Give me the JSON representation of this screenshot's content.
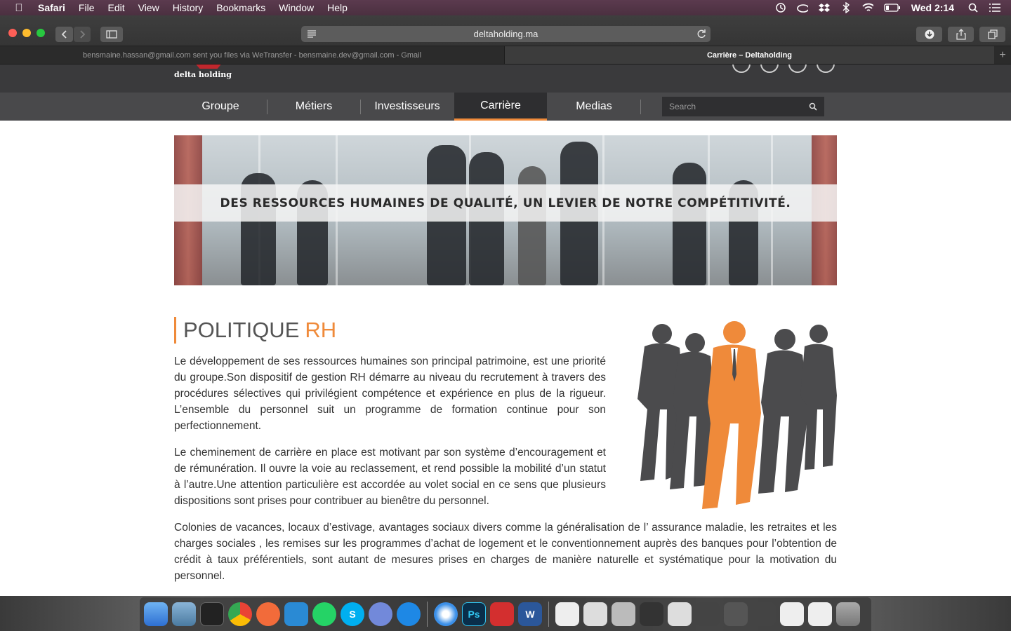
{
  "menubar": {
    "app": "Safari",
    "items": [
      "File",
      "Edit",
      "View",
      "History",
      "Bookmarks",
      "Window",
      "Help"
    ],
    "clock": "Wed 2:14"
  },
  "browser": {
    "url": "deltaholding.ma",
    "tabs": [
      {
        "title": "bensmaine.hassan@gmail.com sent you files via WeTransfer - bensmaine.dev@gmail.com - Gmail",
        "active": false
      },
      {
        "title": "Carrière – Deltaholding",
        "active": true
      }
    ],
    "new_tab": "+"
  },
  "site": {
    "logo": "delta holding",
    "nav": [
      {
        "label": "Groupe"
      },
      {
        "label": "Métiers"
      },
      {
        "label": "Investisseurs"
      },
      {
        "label": "Carrière",
        "active": true
      },
      {
        "label": "Medias"
      }
    ],
    "search_placeholder": "Search",
    "accent_color": "#ef8a3a"
  },
  "banner": {
    "tagline": "DES RESSOURCES HUMAINES DE QUALITÉ, UN LEVIER DE NOTRE COMPÉTITIVITÉ."
  },
  "content": {
    "heading_main": "POLITIQUE",
    "heading_accent": "RH",
    "paragraphs": [
      "Le développement de ses ressources humaines son principal patrimoine, est une priorité du groupe.Son dispositif de gestion RH démarre au niveau du recrutement à travers des procédures sélectives qui privilégient compétence et expérience en plus de la rigueur. L’ensemble du personnel suit un programme de formation continue pour son perfectionnement.",
      "Le cheminement de carrière en place est motivant par son système d’encouragement et de rémunération. Il ouvre la voie au reclassement, et rend possible la mobilité d’un statut à l’autre.Une attention particulière est accordée au volet social en ce sens que plusieurs dispositions sont prises pour contribuer au bienêtre du personnel.",
      "Colonies de vacances, locaux d’estivage, avantages sociaux divers comme la généralisation de l’ assurance maladie, les retraites et les charges sociales , les remises sur les programmes d’achat de logement et le conventionnement auprès des banques pour l’obtention de crédit à taux préférentiels, sont autant de mesures prises en charges de manière naturelle et systématique pour la motivation du personnel."
    ]
  },
  "dock": {
    "apps": [
      "finder-icon",
      "preview-icon",
      "terminal-icon",
      "chrome-icon",
      "swift-icon",
      "vscode-icon",
      "whatsapp-icon",
      "skype-icon",
      "discord-icon",
      "maps-icon",
      "safari-icon",
      "photoshop-icon",
      "acrobat-icon",
      "word-icon"
    ],
    "labels": {
      "photoshop": "Ps",
      "skype": "S",
      "word": "W"
    }
  }
}
